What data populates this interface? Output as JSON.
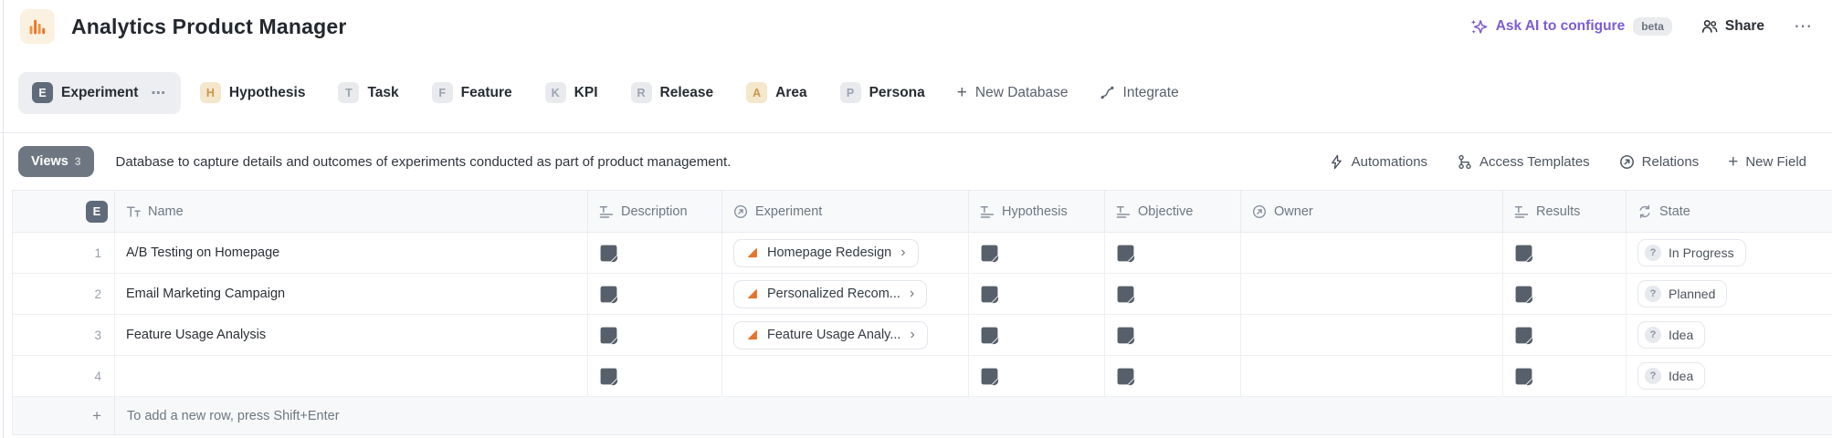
{
  "header": {
    "title": "Analytics Product Manager",
    "ask_ai": "Ask AI to configure",
    "beta": "beta",
    "share": "Share"
  },
  "icons": {
    "dots": "⋯",
    "plus": "+",
    "chevron": "›",
    "question": "?"
  },
  "tabs": {
    "items": [
      {
        "letter": "E",
        "label": "Experiment"
      },
      {
        "letter": "H",
        "label": "Hypothesis"
      },
      {
        "letter": "T",
        "label": "Task"
      },
      {
        "letter": "F",
        "label": "Feature"
      },
      {
        "letter": "K",
        "label": "KPI"
      },
      {
        "letter": "R",
        "label": "Release"
      },
      {
        "letter": "A",
        "label": "Area"
      },
      {
        "letter": "P",
        "label": "Persona"
      }
    ],
    "new_database": "New Database",
    "integrate": "Integrate"
  },
  "views_bar": {
    "views": "Views",
    "count": "3",
    "description": "Database to capture details and outcomes of experiments conducted as part of product management.",
    "automations": "Automations",
    "access_templates": "Access Templates",
    "relations": "Relations",
    "new_field": "New Field"
  },
  "table": {
    "header_badge": "E",
    "columns": [
      {
        "label": "Name",
        "icon": "text-type"
      },
      {
        "label": "Description",
        "icon": "textarea-type"
      },
      {
        "label": "Experiment",
        "icon": "relation-type"
      },
      {
        "label": "Hypothesis",
        "icon": "textarea-type"
      },
      {
        "label": "Objective",
        "icon": "textarea-type"
      },
      {
        "label": "Owner",
        "icon": "relation-type"
      },
      {
        "label": "Results",
        "icon": "textarea-type"
      },
      {
        "label": "State",
        "icon": "state-type"
      }
    ],
    "rows": [
      {
        "num": "1",
        "name": "A/B Testing on Homepage",
        "experiment": "Homepage Redesign",
        "state": "In Progress"
      },
      {
        "num": "2",
        "name": "Email Marketing Campaign",
        "experiment": "Personalized Recom...",
        "state": "Planned"
      },
      {
        "num": "3",
        "name": "Feature Usage Analysis",
        "experiment": "Feature Usage Analy...",
        "state": "Idea"
      },
      {
        "num": "4",
        "name": "",
        "experiment": "",
        "state": "Idea"
      }
    ],
    "add_row_hint": "To add a new row, press Shift+Enter"
  },
  "colors": {
    "accent_orange": "#e8732c",
    "ai_purple": "#7d5bd3",
    "badge_dark_bg": "#5f6b7a",
    "views_button_bg": "#6e7781",
    "tan_badge_bg": "#f5e7cb",
    "border": "#e9ebef"
  }
}
